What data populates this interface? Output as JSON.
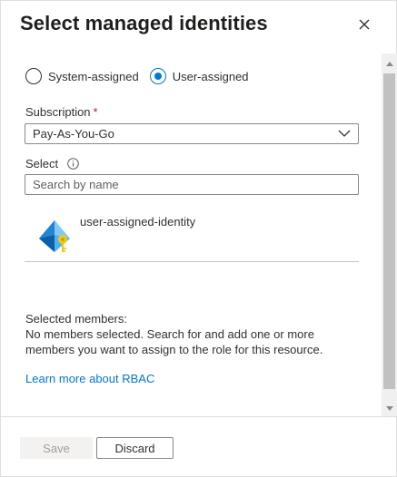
{
  "header": {
    "title": "Select managed identities",
    "close_label": "Close"
  },
  "identity_type": {
    "options": [
      {
        "label": "System-assigned",
        "checked": false
      },
      {
        "label": "User-assigned",
        "checked": true
      }
    ]
  },
  "subscription": {
    "label": "Subscription",
    "required_mark": "*",
    "value": "Pay-As-You-Go"
  },
  "select": {
    "label": "Select",
    "placeholder": "Search by name"
  },
  "results": [
    {
      "name": "user-assigned-identity",
      "icon": "managed-identity-icon"
    }
  ],
  "selected_members": {
    "heading": "Selected members:",
    "message": "No members selected. Search for and add one or more members you want to assign to the role for this resource."
  },
  "learn_more": "Learn more about RBAC",
  "footer": {
    "save_label": "Save",
    "discard_label": "Discard"
  },
  "colors": {
    "accent": "#0078d4",
    "required": "#a4262c",
    "disabled_text": "#a19f9d"
  }
}
